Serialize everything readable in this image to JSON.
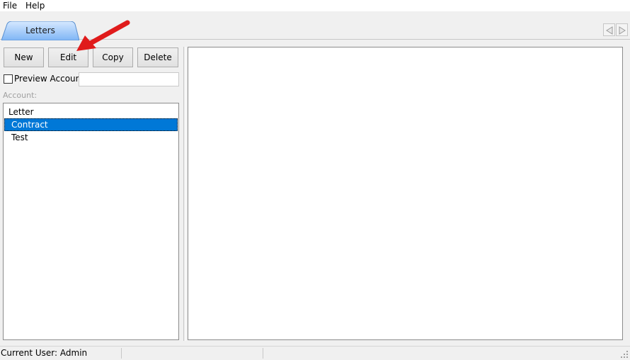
{
  "menu": {
    "items": [
      "File",
      "Help"
    ]
  },
  "tabs": [
    {
      "label": "Letters",
      "active": true
    }
  ],
  "toolbar": {
    "new_label": "New",
    "edit_label": "Edit",
    "copy_label": "Copy",
    "delete_label": "Delete"
  },
  "preview": {
    "checkbox_label": "Preview Account",
    "checked": false,
    "input_value": ""
  },
  "account": {
    "label": "Account:"
  },
  "list": {
    "items": [
      {
        "label": "Letter",
        "level": "header",
        "selected": false
      },
      {
        "label": "Contract",
        "level": "child",
        "selected": true
      },
      {
        "label": "Test",
        "level": "child",
        "selected": false
      }
    ]
  },
  "status": {
    "current_user": "Current User: Admin"
  },
  "colors": {
    "selection": "#0078d7",
    "tab_active_top": "#d6e9ff",
    "tab_active_bottom": "#7fb5f5",
    "annotation_arrow": "#e01b1b"
  },
  "icons": {
    "nav_prev": "triangle-left-icon",
    "nav_next": "triangle-right-icon",
    "resize_grip": "resize-grip-icon"
  }
}
